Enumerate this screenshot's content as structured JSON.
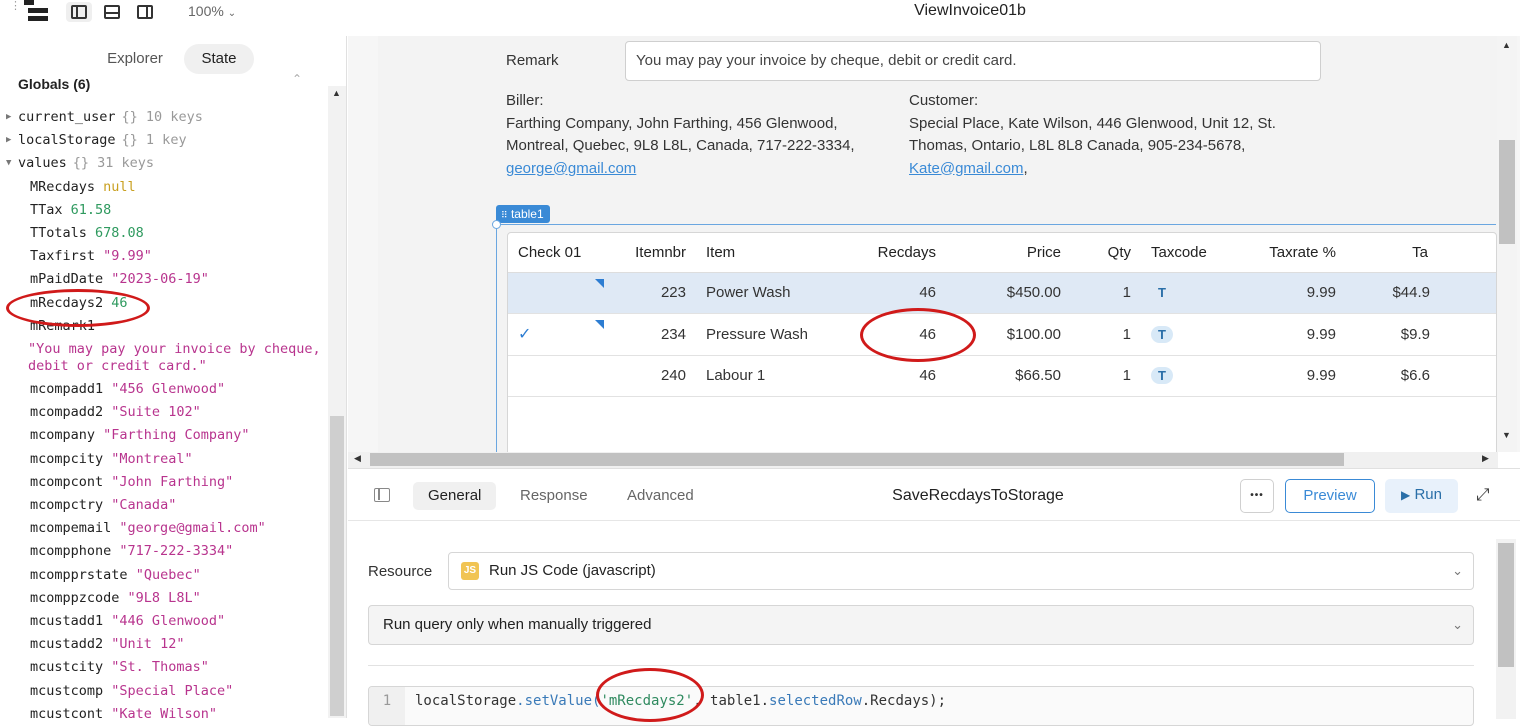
{
  "app": {
    "title": "ViewInvoice01b",
    "zoom": "100%"
  },
  "left_panel": {
    "tabs": [
      {
        "label": "Explorer"
      },
      {
        "label": "State"
      }
    ],
    "globals_label": "Globals (6)",
    "items": {
      "current_user": {
        "key": "current_user",
        "meta": "{}  10 keys"
      },
      "localStorage": {
        "key": "localStorage",
        "meta": "{}  1 key"
      },
      "values": {
        "key": "values",
        "meta": "{}  31 keys"
      }
    },
    "values": [
      {
        "key": "MRecdays",
        "value": "null"
      },
      {
        "key": "TTax",
        "value": "61.58"
      },
      {
        "key": "TTotals",
        "value": "678.08"
      },
      {
        "key": "Taxfirst",
        "value": "\"9.99\""
      },
      {
        "key": "mPaidDate",
        "value": "\"2023-06-19\""
      },
      {
        "key": "mRecdays2",
        "value": "46"
      },
      {
        "key": "mRemark1",
        "value": ""
      },
      {
        "key": "mcompadd1",
        "value": "\"456 Glenwood\""
      },
      {
        "key": "mcompadd2",
        "value": "\"Suite 102\""
      },
      {
        "key": "mcompany",
        "value": "\"Farthing Company\""
      },
      {
        "key": "mcompcity",
        "value": "\"Montreal\""
      },
      {
        "key": "mcompcont",
        "value": "\"John Farthing\""
      },
      {
        "key": "mcompctry",
        "value": "\"Canada\""
      },
      {
        "key": "mcompemail",
        "value": "\"george@gmail.com\""
      },
      {
        "key": "mcompphone",
        "value": "\"717-222-3334\""
      },
      {
        "key": "mcompprstate",
        "value": "\"Quebec\""
      },
      {
        "key": "mcomppzcode",
        "value": "\"9L8 L8L\""
      },
      {
        "key": "mcustadd1",
        "value": "\"446 Glenwood\""
      },
      {
        "key": "mcustadd2",
        "value": "\"Unit 12\""
      },
      {
        "key": "mcustcity",
        "value": "\"St. Thomas\""
      },
      {
        "key": "mcustcomp",
        "value": "\"Special Place\""
      },
      {
        "key": "mcustcont",
        "value": "\"Kate Wilson\""
      }
    ],
    "remark_wrapped": "\"You may pay your invoice by cheque, debit or credit card.\""
  },
  "canvas": {
    "remark_label": "Remark",
    "remark_value": "You may pay your invoice by cheque, debit or credit card.",
    "biler_label": "Biller:",
    "biler_text": "Farthing Company, John Farthing, 456 Glenwood, Montreal, Quebec, 9L8 L8L, Canada, 717-222-3334,",
    "biler_email": "george@gmail.com",
    "customer_label": "Customer:",
    "customer_text": "Special Place, Kate Wilson, 446 Glenwood, Unit 12, St. Thomas, Ontario, L8L 8L8 Canada, 905-234-5678,",
    "customer_email": "Kate@gmail.com",
    "customer_trail": ",",
    "table_tag": "table1",
    "table": {
      "columns": [
        "Check 01",
        "Itemnbr",
        "Item",
        "Recdays",
        "Price",
        "Qty",
        "Taxcode",
        "Taxrate %",
        "Ta"
      ],
      "rows": [
        {
          "check": "",
          "itemnbr": "223",
          "item": "Power Wash",
          "recdays": "46",
          "price": "$450.00",
          "qty": "1",
          "taxcode": "T",
          "taxrate": "9.99",
          "tax": "$44.9"
        },
        {
          "check": "✓",
          "itemnbr": "234",
          "item": "Pressure Wash",
          "recdays": "46",
          "price": "$100.00",
          "qty": "1",
          "taxcode": "T",
          "taxrate": "9.99",
          "tax": "$9.9"
        },
        {
          "check": "",
          "itemnbr": "240",
          "item": "Labour 1",
          "recdays": "46",
          "price": "$66.50",
          "qty": "1",
          "taxcode": "T",
          "taxrate": "9.99",
          "tax": "$6.6"
        }
      ]
    }
  },
  "query": {
    "tabs": [
      {
        "label": "General"
      },
      {
        "label": "Response"
      },
      {
        "label": "Advanced"
      }
    ],
    "name": "SaveRecdaysToStorage",
    "more_label": "•••",
    "preview_label": "Preview",
    "run_label": "Run",
    "resource_label": "Resource",
    "resource_value": "Run JS Code (javascript)",
    "resource_badge": "JS",
    "trigger_value": "Run query only when manually triggered",
    "code_line_number": "1",
    "code": {
      "p1": "localStorage",
      "p2": ".setValue(",
      "p3": "'mRecdays2'",
      "p4": ", table1.",
      "p5": "selectedRow",
      "p6": ".Recdays);"
    }
  },
  "colors": {
    "accent": "#3a8ad6",
    "annotation": "#d01a1a",
    "string": "#b8348e",
    "number": "#2f9a5f"
  }
}
